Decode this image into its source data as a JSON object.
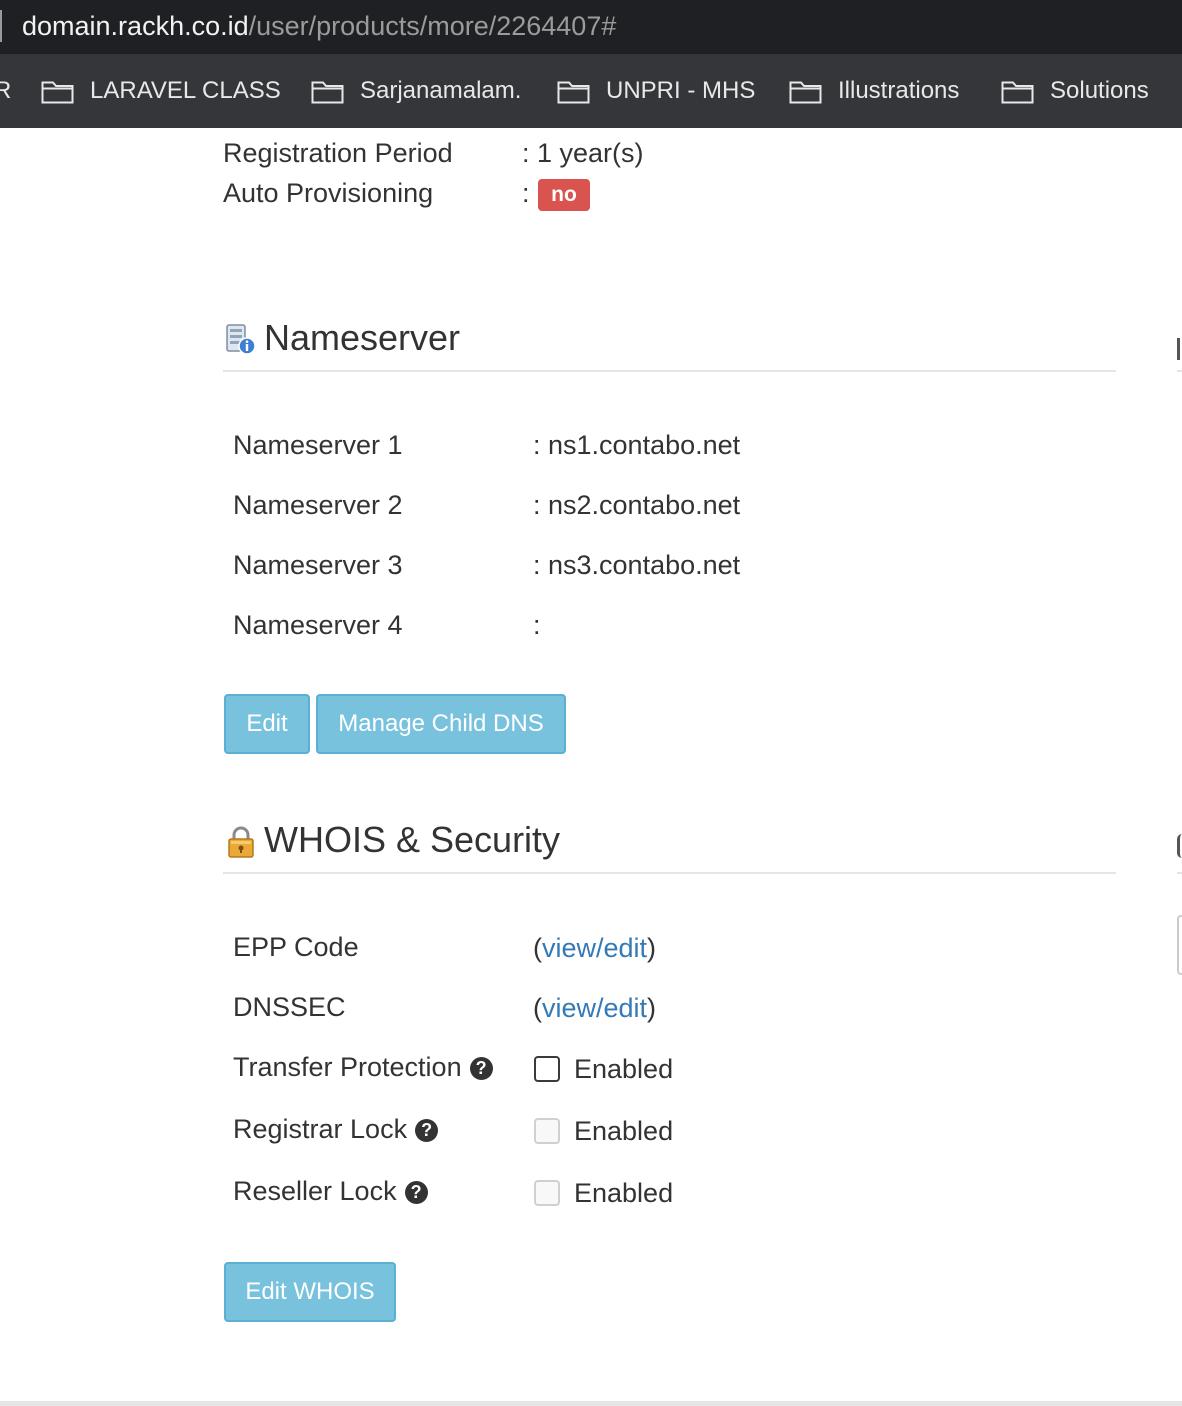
{
  "browser": {
    "url_host": "domain.rackh.co.id",
    "url_path": "/user/products/more/2264407#",
    "bookmark_cut": "R",
    "bookmarks": [
      {
        "label": "LARAVEL CLASS"
      },
      {
        "label": "Sarjanamalam."
      },
      {
        "label": "UNPRI - MHS"
      },
      {
        "label": "Illustrations"
      },
      {
        "label": "Solutions"
      }
    ]
  },
  "registration": {
    "period_label": "Registration Period",
    "period_value": ": 1 year(s)",
    "auto_label": "Auto Provisioning",
    "auto_sep": ":",
    "auto_value": "no",
    "auto_value_color": "#d9534f"
  },
  "nameserver": {
    "title": "Nameserver",
    "icon": "server-info-icon",
    "rows": [
      {
        "label": "Nameserver 1",
        "value": ": ns1.contabo.net"
      },
      {
        "label": "Nameserver 2",
        "value": ": ns2.contabo.net"
      },
      {
        "label": "Nameserver 3",
        "value": ": ns3.contabo.net"
      },
      {
        "label": "Nameserver 4",
        "value": ":"
      }
    ],
    "edit_button": "Edit",
    "child_dns_button": "Manage Child DNS"
  },
  "whois": {
    "title": "WHOIS & Security",
    "icon": "padlock-icon",
    "epp_label": "EPP Code",
    "dnssec_label": "DNSSEC",
    "paren_open": "(",
    "paren_close": ")",
    "view_edit": "view/edit",
    "transfer_label": "Transfer Protection",
    "registrar_label": "Registrar Lock",
    "reseller_label": "Reseller Lock",
    "help_glyph": "?",
    "enabled_label": "Enabled",
    "edit_whois_button": "Edit WHOIS"
  },
  "colors": {
    "info_button": "#78c2de",
    "link": "#337ab7",
    "danger": "#d9534f"
  }
}
